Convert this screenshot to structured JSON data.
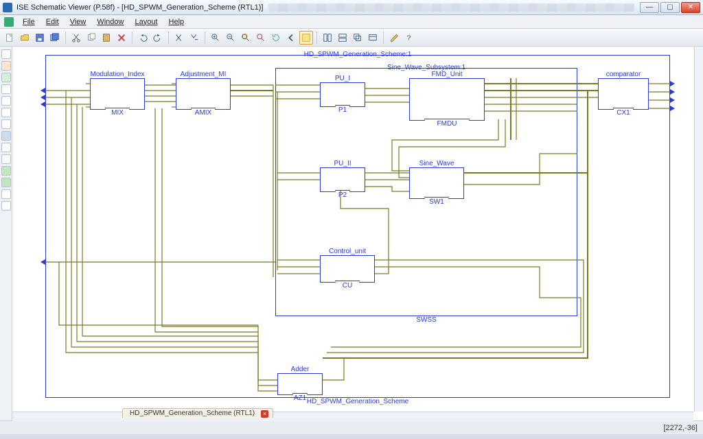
{
  "window": {
    "title": "ISE Schematic Viewer (P.58f) - [HD_SPWM_Generation_Scheme (RTL1)]"
  },
  "menu": [
    "File",
    "Edit",
    "View",
    "Window",
    "Layout",
    "Help"
  ],
  "doc_tab": "HD_SPWM_Generation_Scheme (RTL1)",
  "status_coords": "[2272,-36]",
  "top_frame": {
    "title_top": "HD_SPWM_Generation_Scheme:1",
    "title_bottom": "HD_SPWM_Generation_Scheme"
  },
  "sine_subsys": {
    "title_top": "Sine_Wave_Subsystem:1",
    "title_bottom": "SWSS"
  },
  "components": {
    "mix": {
      "title": "Modulation_Index",
      "inst": "MIX"
    },
    "amix": {
      "title": "Adjustment_MI",
      "inst": "AMIX"
    },
    "p1": {
      "title": "PU_I",
      "inst": "P1"
    },
    "p2": {
      "title": "PU_II",
      "inst": "P2"
    },
    "fmdu": {
      "title": "FMD_Unit",
      "inst": "FMDU"
    },
    "sw1": {
      "title": "Sine_Wave",
      "inst": "SW1"
    },
    "cu": {
      "title": "Control_unit",
      "inst": "CU"
    },
    "cx1": {
      "title": "comparator",
      "inst": "CX1"
    },
    "az1": {
      "title": "Adder",
      "inst": "AZ1"
    }
  },
  "colors": {
    "wire": "#7a7a1e",
    "schematic_blue": "#2a39d8"
  }
}
